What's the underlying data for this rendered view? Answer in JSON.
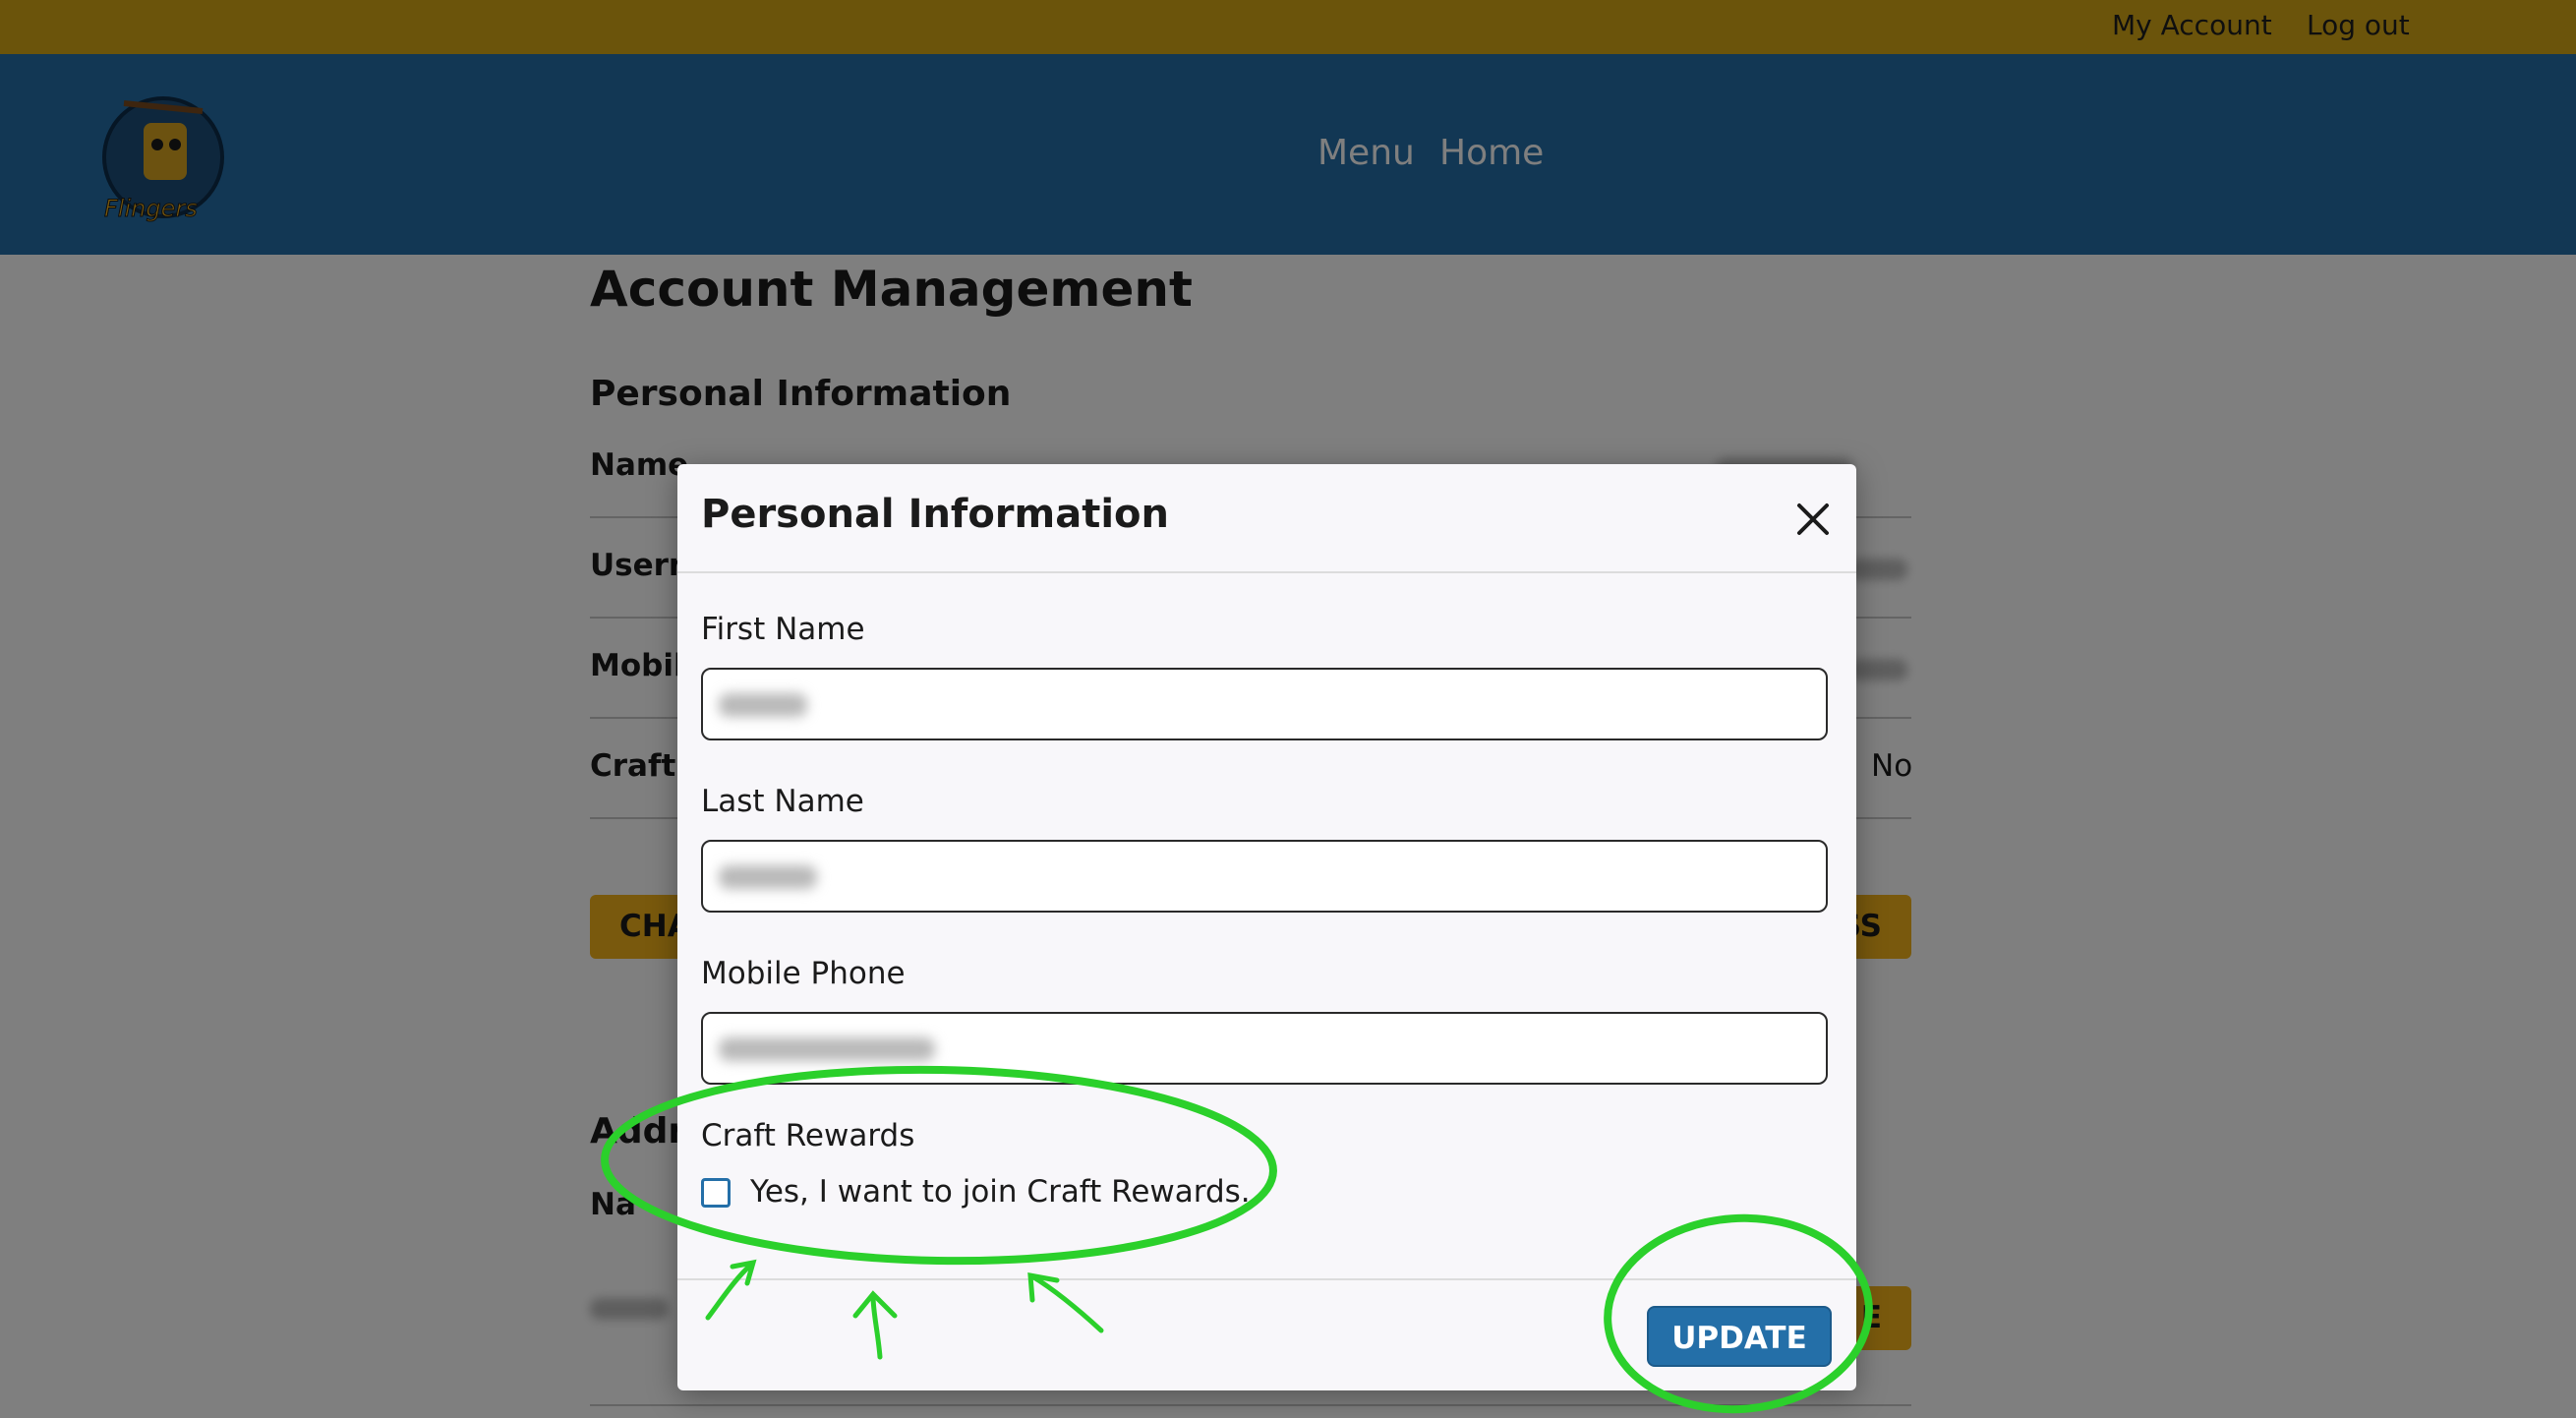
{
  "topbar": {
    "my_account": "My Account",
    "log_out": "Log out"
  },
  "logo": {
    "text": "Flingers"
  },
  "nav": {
    "menu": "Menu",
    "home": "Home"
  },
  "page": {
    "title": "Account Management",
    "section_title": "Personal Information",
    "rows": [
      {
        "label": "Name"
      },
      {
        "label": "Usern"
      },
      {
        "label": "Mobil"
      },
      {
        "label": "Craft",
        "value": "No"
      }
    ],
    "change_button_partial": "CHA",
    "address_button_partial": "SS",
    "address_heading_partial": "Addr",
    "address_name_partial": "Na",
    "address_action_partial": "E"
  },
  "modal": {
    "title": "Personal Information",
    "close_icon": "close-icon",
    "first_name_label": "First Name",
    "last_name_label": "Last Name",
    "mobile_phone_label": "Mobile Phone",
    "craft_rewards_label": "Craft Rewards",
    "craft_rewards_checkbox_label": "Yes, I want to join Craft Rewards.",
    "craft_rewards_checked": false,
    "update_button": "UPDATE"
  },
  "colors": {
    "topbar": "#d6a916",
    "header": "#246fa8",
    "accent_yellow": "#f2b21b",
    "primary_blue": "#246fa8",
    "annotation_green": "#2bd02b"
  }
}
